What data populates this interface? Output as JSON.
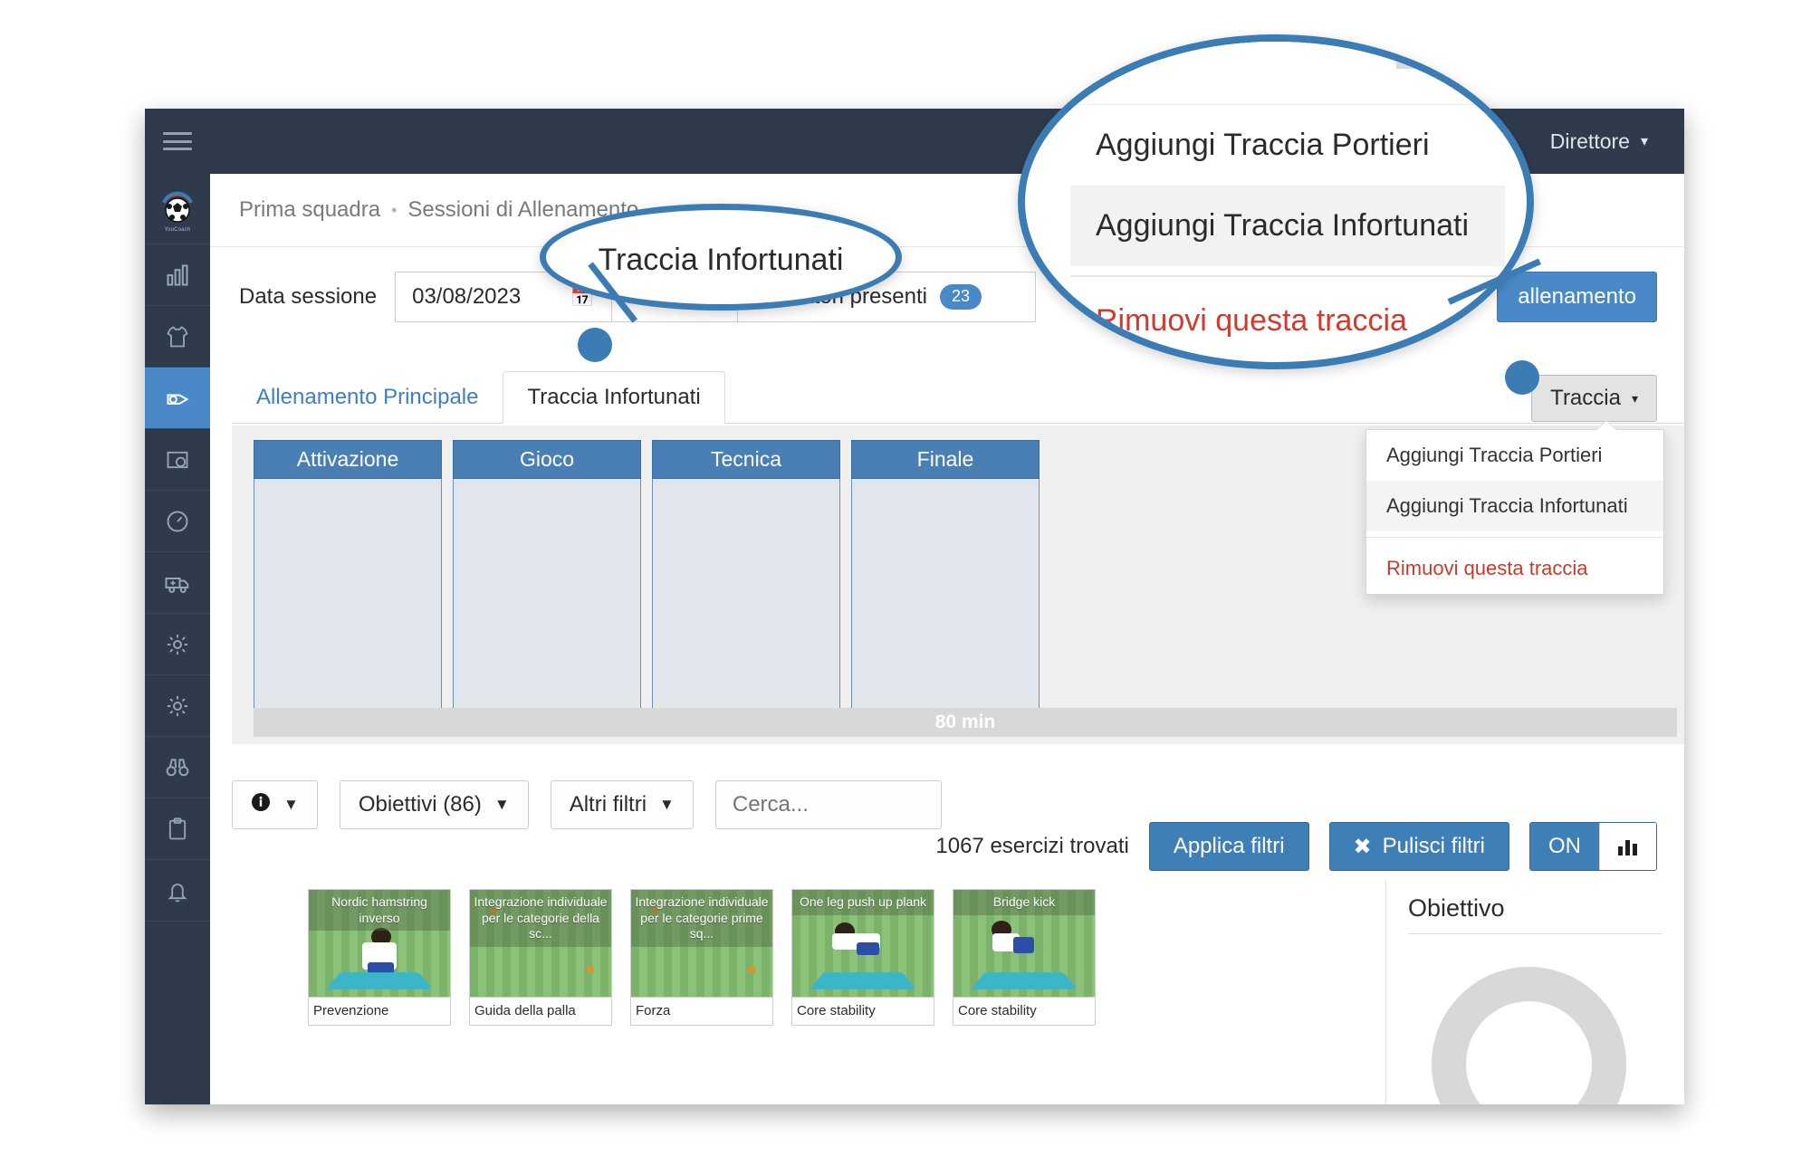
{
  "window": {
    "topbar": {
      "hamburger_icon": "hamburger-menu-icon",
      "user_label": "Direttore",
      "user_caret": "⌄"
    },
    "sidebar": {
      "brand_label": "YouCoach",
      "items": [
        {
          "name": "logo",
          "icon": "soccer-ball-logo-icon",
          "active": false
        },
        {
          "name": "statistics",
          "icon": "bar-chart-icon",
          "active": false
        },
        {
          "name": "team",
          "icon": "jersey-icon",
          "active": false
        },
        {
          "name": "training",
          "icon": "whistle-icon",
          "active": true
        },
        {
          "name": "match",
          "icon": "pitch-ball-icon",
          "active": false
        },
        {
          "name": "performance",
          "icon": "speedometer-icon",
          "active": false
        },
        {
          "name": "medical",
          "icon": "ambulance-icon",
          "active": false
        },
        {
          "name": "settings",
          "icon": "gear-icon",
          "active": false
        },
        {
          "name": "settings-2",
          "icon": "gear-icon",
          "active": false
        },
        {
          "name": "scouting",
          "icon": "binoculars-icon",
          "active": false
        },
        {
          "name": "reports",
          "icon": "clipboard-icon",
          "active": false
        },
        {
          "name": "notifications",
          "icon": "bell-icon",
          "active": false
        }
      ]
    }
  },
  "breadcrumb": {
    "items": [
      "Prima squadra",
      "Sessioni di Allenamento"
    ],
    "separator": "•"
  },
  "session": {
    "date_label": "Data sessione",
    "date_value": "03/08/2023",
    "calendar_icon": "calendar-icon",
    "time_value": "",
    "players_icon": "users-icon",
    "players_label": "catori presenti",
    "players_count": "23",
    "save_button": "allenamento"
  },
  "tabs": [
    {
      "label": "Allenamento Principale",
      "active": false
    },
    {
      "label": "Traccia Infortunati",
      "active": true
    }
  ],
  "traccia_button": {
    "label": "Traccia",
    "caret_icon": "chevron-down-icon"
  },
  "traccia_menu": {
    "items": [
      {
        "label": "Aggiungi Traccia Portieri",
        "kind": "normal"
      },
      {
        "label": "Aggiungi Traccia Infortunati",
        "kind": "hover"
      },
      {
        "label": "Rimuovi questa traccia",
        "kind": "danger"
      }
    ]
  },
  "board": {
    "phases": [
      "Attivazione",
      "Gioco",
      "Tecnica",
      "Finale"
    ],
    "duration_label": "80 min"
  },
  "filters": {
    "info_button_icon": "info-circle-icon",
    "objectives_label": "Obiettivi (86)",
    "other_filters_label": "Altri filtri",
    "search_placeholder": "Cerca...",
    "found_count": "1067 esercizi trovati",
    "apply_label": "Applica filtri",
    "clear_label": "Pulisci filtri",
    "clear_icon": "close-x-icon",
    "toggle_label": "ON",
    "toggle_chart_icon": "bar-chart-icon"
  },
  "cards": [
    {
      "title": "Nordic hamstring inverso",
      "category": "Prevenzione",
      "figure": "kneel"
    },
    {
      "title": "Integrazione individuale per le categorie della sc...",
      "category": "Guida della palla",
      "figure": "drill"
    },
    {
      "title": "Integrazione individuale per le categorie prime sq...",
      "category": "Forza",
      "figure": "drill"
    },
    {
      "title": "One leg push up plank",
      "category": "Core stability",
      "figure": "plank"
    },
    {
      "title": "Bridge kick",
      "category": "Core stability",
      "figure": "bridge"
    }
  ],
  "objective_panel": {
    "title": "Obiettivo",
    "chart_icon": "donut-chart-icon"
  },
  "callouts": {
    "tab_zoom_text": "Traccia Infortunati",
    "menu_zoom_items": [
      {
        "label": "Aggiungi Traccia Portieri",
        "kind": "normal"
      },
      {
        "label": "Aggiungi Traccia Infortunati",
        "kind": "hover"
      },
      {
        "label": "Rimuovi questa traccia",
        "kind": "danger"
      }
    ]
  }
}
